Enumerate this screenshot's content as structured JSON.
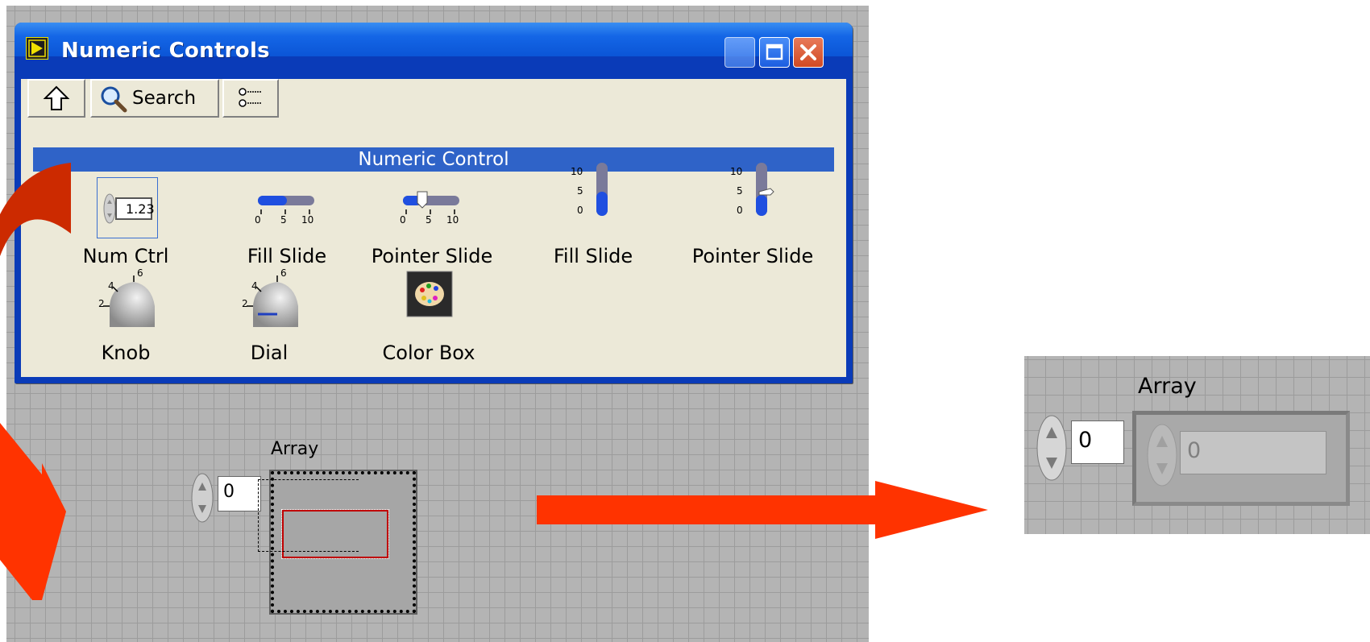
{
  "window": {
    "title": "Numeric Controls"
  },
  "toolbar": {
    "search_label": "Search"
  },
  "category": "Numeric Control",
  "palette_items": [
    {
      "label": "Num Ctrl",
      "icon": "numeric-control-icon",
      "value": "1.23"
    },
    {
      "label": "Fill Slide",
      "icon": "horizontal-fill-slide-icon",
      "scale": [
        "0",
        "5",
        "10"
      ]
    },
    {
      "label": "Pointer Slide",
      "icon": "horizontal-pointer-slide-icon",
      "scale": [
        "0",
        "5",
        "10"
      ]
    },
    {
      "label": "Fill Slide",
      "icon": "vertical-fill-slide-icon",
      "scale": [
        "10",
        "5",
        "0"
      ]
    },
    {
      "label": "Pointer Slide",
      "icon": "vertical-pointer-slide-icon",
      "scale": [
        "10",
        "5",
        "0"
      ]
    },
    {
      "label": "Knob",
      "icon": "knob-icon",
      "scale": [
        "2",
        "4",
        "6"
      ]
    },
    {
      "label": "Dial",
      "icon": "dial-icon",
      "scale": [
        "2",
        "4",
        "6"
      ]
    },
    {
      "label": "Color Box",
      "icon": "color-box-icon"
    }
  ],
  "array_left": {
    "label": "Array",
    "index": "0"
  },
  "array_right": {
    "label": "Array",
    "index": "0",
    "element_value": "0"
  },
  "colors": {
    "arrow": "#ff3300",
    "arrow_dark": "#cc2a00",
    "titlebar": "#1466e6",
    "category_bar": "#2f63c8"
  }
}
